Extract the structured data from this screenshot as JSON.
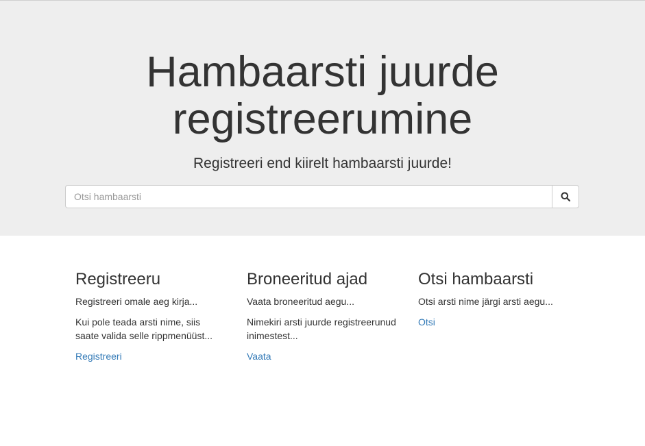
{
  "hero": {
    "title": "Hambaarsti juurde registreerumine",
    "subtitle": "Registreeri end kiirelt hambaarsti juurde!"
  },
  "search": {
    "placeholder": "Otsi hambaarsti",
    "value": "",
    "button_icon": "search-icon"
  },
  "columns": [
    {
      "title": "Registreeru",
      "texts": [
        "Registreeri omale aeg kirja...",
        "Kui pole teada arsti nime, siis saate valida selle rippmenüüst..."
      ],
      "link": "Registreeri"
    },
    {
      "title": "Broneeritud ajad",
      "texts": [
        "Vaata broneeritud aegu...",
        "Nimekiri arsti juurde registreerunud inimestest..."
      ],
      "link": "Vaata"
    },
    {
      "title": "Otsi hambaarsti",
      "texts": [
        "Otsi arsti nime järgi arsti aegu..."
      ],
      "link": "Otsi"
    }
  ],
  "colors": {
    "jumbotron_bg": "#eeeeee",
    "text": "#333333",
    "link": "#337ab7"
  }
}
